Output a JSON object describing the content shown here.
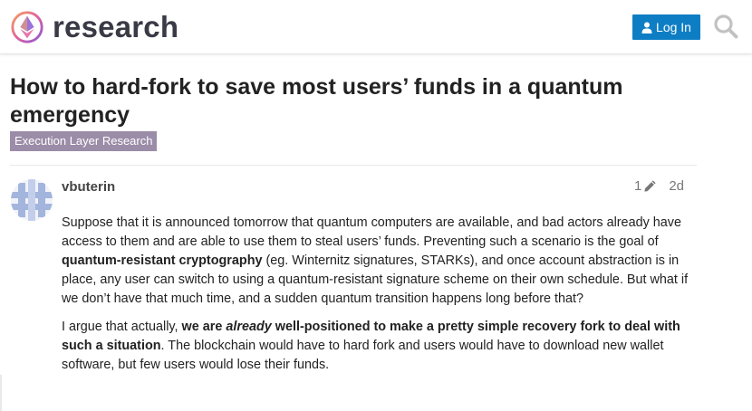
{
  "header": {
    "site_name": "research",
    "login_label": "Log In",
    "icons": {
      "logo": "ethereum-logo-icon",
      "login": "user-icon",
      "search": "search-icon"
    }
  },
  "topic": {
    "title": "How to hard-fork to save most users’ funds in a quantum emergency",
    "category": "Execution Layer Research"
  },
  "post": {
    "author": "vbuterin",
    "edit_count": "1",
    "age": "2d",
    "p1": {
      "t1": "Suppose that it is announced tomorrow that quantum computers are available, and bad actors already have access to them and are able to use them to steal users’ funds. Preventing such a scenario is the goal of ",
      "b1": "quantum-resistant cryptography",
      "t2": " (eg. Winternitz signatures, STARKs), and once account abstraction is in place, any user can switch to using a quantum-resistant signature scheme on their own schedule. But what if we don’t have that much time, and a sudden quantum transition happens long before that?"
    },
    "p2": {
      "t1": "I argue that actually, ",
      "b1": "we are ",
      "bi": "already",
      "b2": " well-positioned to make a pretty simple recovery fork to deal with such a situation",
      "t2": ". The blockchain would have to hard fork and users would have to download new wallet software, but few users would lose their funds."
    }
  },
  "colors": {
    "accent_button": "#0e7ec4",
    "category_badge": "#9b8ca8",
    "title_text": "#222222",
    "avatar": "#a3b5dd"
  }
}
